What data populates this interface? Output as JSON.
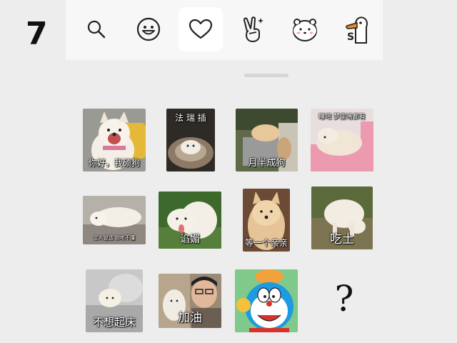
{
  "step_number": "7",
  "toolbar": {
    "tabs": [
      {
        "name": "search",
        "icon": "search-icon",
        "active": false
      },
      {
        "name": "emoji",
        "icon": "smiley-face-icon",
        "active": false
      },
      {
        "name": "favorites",
        "icon": "heart-icon",
        "active": true
      },
      {
        "name": "gesture",
        "icon": "victory-hand-icon",
        "active": false
      },
      {
        "name": "bear-pack",
        "icon": "white-bear-sticker-icon",
        "active": false
      },
      {
        "name": "duck-pack",
        "icon": "duck-sticker-icon",
        "active": false
      }
    ],
    "duck_badge": "S"
  },
  "stickers": [
    {
      "caption": "你好，我硕狗"
    },
    {
      "caption": "法 瑞 插"
    },
    {
      "caption": "月半成狗"
    },
    {
      "caption": "睡吧  梦里啥都有"
    },
    {
      "caption": "主人说话  你听不懂"
    },
    {
      "caption": "谄媚"
    },
    {
      "caption": "等一个亲亲"
    },
    {
      "caption": "吃土"
    },
    {
      "caption": "不想起床"
    },
    {
      "caption": "加油"
    },
    {
      "caption": ""
    }
  ],
  "more_placeholder": "?",
  "colors": {
    "background": "#ededed",
    "toolbar": "#f7f7f7",
    "active_tab": "#ffffff",
    "doraemon_blue": "#1e9be0"
  }
}
